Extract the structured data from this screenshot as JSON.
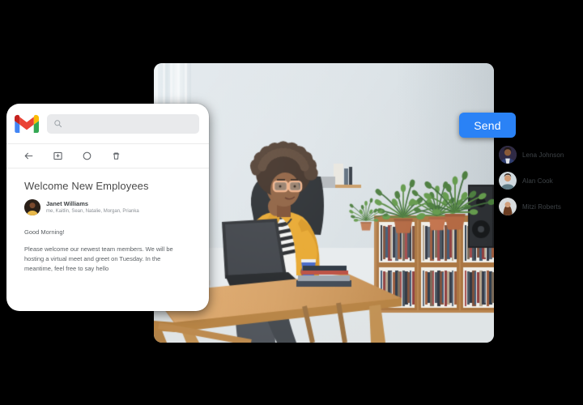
{
  "gmail": {
    "logo": "gmail-logo-icon",
    "search": {
      "placeholder": "",
      "value": "",
      "icon": "search-icon"
    },
    "toolbar": {
      "icons": [
        "back-arrow-icon",
        "archive-icon",
        "mark-unread-circle-icon",
        "delete-trash-icon"
      ]
    },
    "email": {
      "subject": "Welcome New Employees",
      "sender": "Janet Williams",
      "recipients": "me, Kaitlin, Sean, Natalie, Morgan, Prianka",
      "greeting": "Good Morning!",
      "body": "Please welcome our newest team members. We will be hosting a virtual meet and greet on Tuesday. In the meantime, feel free to say hello"
    }
  },
  "send_button": {
    "label": "Send",
    "color": "#2a82f6",
    "text_color": "#ffffff"
  },
  "participants": [
    {
      "name": "Lena Johnson"
    },
    {
      "name": "Alan Cook"
    },
    {
      "name": "Mitzi Roberts"
    }
  ],
  "photo": {
    "description": "Woman in yellow cardigan with glasses sitting at a wooden table with a laptop, holding a blue cup, plants and record shelves behind"
  },
  "background_color": "#000000"
}
